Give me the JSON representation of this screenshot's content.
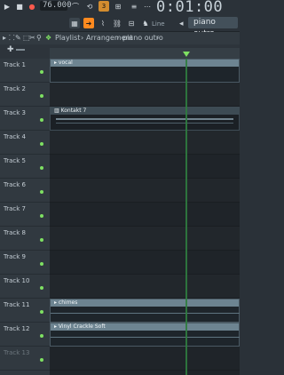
{
  "transport": {
    "tempo": "76.000",
    "pat_label": "PAT",
    "time": "0:01:00"
  },
  "toolbar": {
    "snap_label": "Line",
    "pattern_name": "piano outro"
  },
  "playlist": {
    "breadcrumb": [
      "Playlist",
      "Arrangement",
      "piano outro"
    ]
  },
  "tracks": [
    {
      "label": "Track 1"
    },
    {
      "label": "Track 2"
    },
    {
      "label": "Track 3"
    },
    {
      "label": "Track 4"
    },
    {
      "label": "Track 5"
    },
    {
      "label": "Track 6"
    },
    {
      "label": "Track 7"
    },
    {
      "label": "Track 8"
    },
    {
      "label": "Track 9"
    },
    {
      "label": "Track 10"
    },
    {
      "label": "Track 11"
    },
    {
      "label": "Track 12"
    },
    {
      "label": "Track 13"
    }
  ],
  "clips": [
    {
      "track": 1,
      "name": "vocal"
    },
    {
      "track": 3,
      "name": "Kontakt 7"
    },
    {
      "track": 11,
      "name": "chimes"
    },
    {
      "track": 12,
      "name": "Vinyl Crackle Soft"
    }
  ],
  "colors": {
    "accent_orange": "#ff8a1f",
    "track_dot": "#7ee062",
    "playhead": "#2f7d3f"
  }
}
